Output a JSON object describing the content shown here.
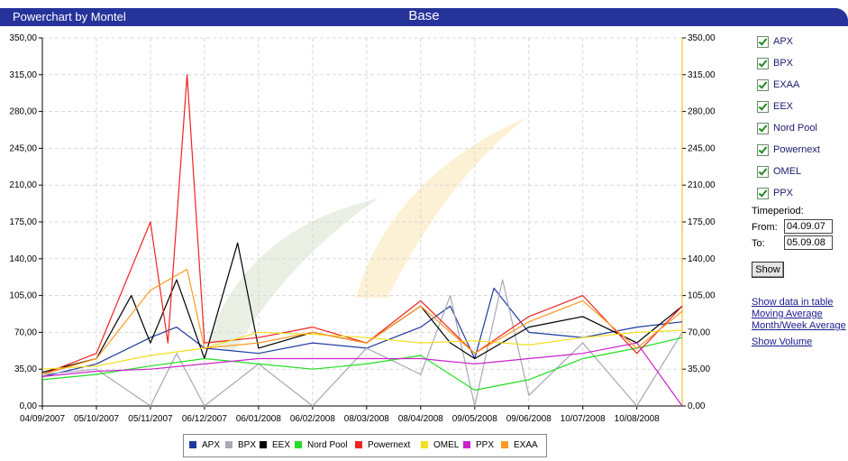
{
  "header": {
    "app_title": "Powerchart by Montel",
    "chart_title": "Base"
  },
  "sidebar": {
    "checkboxes": [
      {
        "label": "APX",
        "checked": true
      },
      {
        "label": "BPX",
        "checked": true
      },
      {
        "label": "EXAA",
        "checked": true
      },
      {
        "label": "EEX",
        "checked": true
      },
      {
        "label": "Nord Pool",
        "checked": true
      },
      {
        "label": "Powernext",
        "checked": true
      },
      {
        "label": "OMEL",
        "checked": true
      },
      {
        "label": "PPX",
        "checked": true
      }
    ],
    "timeperiod_label": "Timeperiod:",
    "from_label": "From:",
    "from_value": "04.09.07",
    "to_label": "To:",
    "to_value": "05.09.08",
    "show_button": "Show",
    "links": [
      "Show data in table",
      "Moving Average",
      "Month/Week Average",
      "Show Volume"
    ]
  },
  "chart_data": {
    "type": "line",
    "title": "Base",
    "xlabel": "",
    "ylabel": "",
    "ylim": [
      0,
      350
    ],
    "yticks": [
      "0,00",
      "35,00",
      "70,00",
      "105,00",
      "140,00",
      "175,00",
      "210,00",
      "245,00",
      "280,00",
      "315,00",
      "350,00"
    ],
    "xtick_labels": [
      "04/09/2007",
      "05/10/2007",
      "05/11/2007",
      "06/12/2007",
      "06/01/2008",
      "06/02/2008",
      "08/03/2008",
      "08/04/2008",
      "09/05/2008",
      "09/06/2008",
      "10/07/2008",
      "10/08/2008"
    ],
    "x_range": [
      "2007-09-04",
      "2008-09-05"
    ],
    "grid": true,
    "legend_position": "bottom",
    "series_samples_note_free": true,
    "series": [
      {
        "name": "APX",
        "color": "#1f3a9e",
        "points": [
          [
            "2007-09-04",
            28
          ],
          [
            "2007-10-05",
            40
          ],
          [
            "2007-11-05",
            65
          ],
          [
            "2007-11-20",
            75
          ],
          [
            "2007-12-06",
            55
          ],
          [
            "2008-01-06",
            50
          ],
          [
            "2008-02-06",
            60
          ],
          [
            "2008-03-08",
            55
          ],
          [
            "2008-04-08",
            75
          ],
          [
            "2008-04-25",
            95
          ],
          [
            "2008-05-09",
            45
          ],
          [
            "2008-05-20",
            112
          ],
          [
            "2008-06-09",
            70
          ],
          [
            "2008-07-10",
            65
          ],
          [
            "2008-08-10",
            75
          ],
          [
            "2008-09-05",
            80
          ]
        ]
      },
      {
        "name": "BPX",
        "color": "#a8a8b8",
        "points": [
          [
            "2007-09-04",
            30
          ],
          [
            "2007-10-05",
            35
          ],
          [
            "2007-11-05",
            0
          ],
          [
            "2007-11-20",
            50
          ],
          [
            "2007-12-06",
            0
          ],
          [
            "2008-01-06",
            40
          ],
          [
            "2008-02-06",
            0
          ],
          [
            "2008-03-08",
            55
          ],
          [
            "2008-04-08",
            30
          ],
          [
            "2008-04-25",
            105
          ],
          [
            "2008-05-09",
            0
          ],
          [
            "2008-05-25",
            120
          ],
          [
            "2008-06-09",
            10
          ],
          [
            "2008-07-10",
            60
          ],
          [
            "2008-08-10",
            0
          ],
          [
            "2008-09-05",
            70
          ]
        ]
      },
      {
        "name": "EEX",
        "color": "#000000",
        "points": [
          [
            "2007-09-04",
            32
          ],
          [
            "2007-10-05",
            45
          ],
          [
            "2007-10-25",
            105
          ],
          [
            "2007-11-05",
            60
          ],
          [
            "2007-11-20",
            120
          ],
          [
            "2007-12-06",
            45
          ],
          [
            "2007-12-25",
            155
          ],
          [
            "2008-01-06",
            55
          ],
          [
            "2008-02-06",
            70
          ],
          [
            "2008-03-08",
            60
          ],
          [
            "2008-04-08",
            95
          ],
          [
            "2008-04-25",
            60
          ],
          [
            "2008-05-09",
            45
          ],
          [
            "2008-06-09",
            75
          ],
          [
            "2008-07-10",
            85
          ],
          [
            "2008-08-10",
            60
          ],
          [
            "2008-09-05",
            95
          ]
        ]
      },
      {
        "name": "Nord Pool",
        "color": "#22dd22",
        "points": [
          [
            "2007-09-04",
            25
          ],
          [
            "2007-10-05",
            30
          ],
          [
            "2007-11-05",
            38
          ],
          [
            "2007-12-06",
            45
          ],
          [
            "2008-01-06",
            40
          ],
          [
            "2008-02-06",
            35
          ],
          [
            "2008-03-08",
            40
          ],
          [
            "2008-04-08",
            48
          ],
          [
            "2008-05-09",
            15
          ],
          [
            "2008-06-09",
            25
          ],
          [
            "2008-07-10",
            45
          ],
          [
            "2008-08-10",
            55
          ],
          [
            "2008-09-05",
            65
          ]
        ]
      },
      {
        "name": "Powernext",
        "color": "#ee2222",
        "points": [
          [
            "2007-09-04",
            30
          ],
          [
            "2007-10-05",
            50
          ],
          [
            "2007-11-05",
            175
          ],
          [
            "2007-11-15",
            60
          ],
          [
            "2007-11-26",
            315
          ],
          [
            "2007-12-06",
            60
          ],
          [
            "2008-01-06",
            65
          ],
          [
            "2008-02-06",
            75
          ],
          [
            "2008-03-08",
            60
          ],
          [
            "2008-04-08",
            100
          ],
          [
            "2008-05-09",
            50
          ],
          [
            "2008-06-09",
            85
          ],
          [
            "2008-07-10",
            105
          ],
          [
            "2008-08-10",
            50
          ],
          [
            "2008-09-05",
            95
          ]
        ]
      },
      {
        "name": "OMEL",
        "color": "#f0e020",
        "points": [
          [
            "2007-09-04",
            35
          ],
          [
            "2007-10-05",
            38
          ],
          [
            "2007-11-05",
            48
          ],
          [
            "2007-12-06",
            55
          ],
          [
            "2008-01-06",
            70
          ],
          [
            "2008-02-06",
            68
          ],
          [
            "2008-03-08",
            65
          ],
          [
            "2008-04-08",
            60
          ],
          [
            "2008-05-09",
            62
          ],
          [
            "2008-06-09",
            58
          ],
          [
            "2008-07-10",
            65
          ],
          [
            "2008-08-10",
            70
          ],
          [
            "2008-09-05",
            72
          ]
        ]
      },
      {
        "name": "PPX",
        "color": "#cc22cc",
        "points": [
          [
            "2007-09-04",
            28
          ],
          [
            "2007-10-05",
            33
          ],
          [
            "2007-11-05",
            35
          ],
          [
            "2007-12-06",
            40
          ],
          [
            "2008-01-06",
            45
          ],
          [
            "2008-02-06",
            45
          ],
          [
            "2008-03-08",
            45
          ],
          [
            "2008-04-08",
            45
          ],
          [
            "2008-05-09",
            40
          ],
          [
            "2008-06-09",
            45
          ],
          [
            "2008-07-10",
            50
          ],
          [
            "2008-08-10",
            60
          ],
          [
            "2008-09-05",
            0
          ]
        ]
      },
      {
        "name": "EXAA",
        "color": "#ff9a20",
        "points": [
          [
            "2007-09-04",
            30
          ],
          [
            "2007-10-05",
            45
          ],
          [
            "2007-11-05",
            110
          ],
          [
            "2007-11-26",
            130
          ],
          [
            "2007-12-06",
            55
          ],
          [
            "2008-01-06",
            60
          ],
          [
            "2008-02-06",
            70
          ],
          [
            "2008-03-08",
            60
          ],
          [
            "2008-04-08",
            95
          ],
          [
            "2008-05-09",
            50
          ],
          [
            "2008-06-09",
            80
          ],
          [
            "2008-07-10",
            100
          ],
          [
            "2008-08-10",
            55
          ],
          [
            "2008-09-05",
            90
          ]
        ]
      }
    ]
  },
  "legend": {
    "items": [
      "APX",
      "BPX",
      "EEX",
      "Nord Pool",
      "Powernext",
      "OMEL",
      "PPX",
      "EXAA"
    ]
  }
}
